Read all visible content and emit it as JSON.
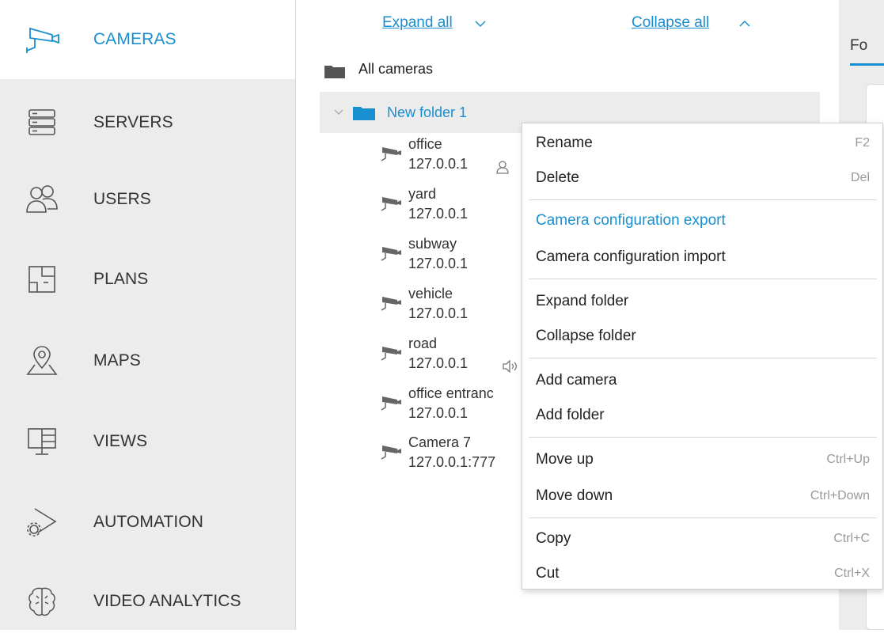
{
  "sidebar": {
    "items": [
      {
        "label": "CAMERAS",
        "icon": "camera-icon",
        "active": true
      },
      {
        "label": "SERVERS",
        "icon": "server-icon"
      },
      {
        "label": "USERS",
        "icon": "users-icon"
      },
      {
        "label": "PLANS",
        "icon": "floor-plan-icon"
      },
      {
        "label": "MAPS",
        "icon": "map-pin-icon"
      },
      {
        "label": "VIEWS",
        "icon": "monitor-grid-icon"
      },
      {
        "label": "AUTOMATION",
        "icon": "automation-gear-icon"
      },
      {
        "label": "VIDEO ANALYTICS",
        "icon": "brain-icon"
      }
    ],
    "active_color": "#1a8fd0"
  },
  "tree": {
    "expand_all": "Expand all",
    "collapse_all": "Collapse all",
    "root_label": "All cameras",
    "folder_label": "New folder 1",
    "cameras": [
      {
        "name": "office",
        "ip": "127.0.0.1",
        "badge": "user-icon"
      },
      {
        "name": "yard",
        "ip": "127.0.0.1"
      },
      {
        "name": "subway",
        "ip": "127.0.0.1"
      },
      {
        "name": "vehicle",
        "ip": "127.0.0.1"
      },
      {
        "name": "road",
        "ip": "127.0.0.1",
        "badge": "speaker-icon"
      },
      {
        "name": "office entranc",
        "ip": "127.0.0.1"
      },
      {
        "name": "Camera 7",
        "ip": "127.0.0.1:777"
      }
    ]
  },
  "right_panel": {
    "tab_text": "Fo"
  },
  "context_menu": {
    "items": [
      {
        "label": "Rename",
        "shortcut": "F2"
      },
      {
        "label": "Delete",
        "shortcut": "Del"
      },
      {
        "label": "Camera configuration export",
        "shortcut": "",
        "highlighted": true
      },
      {
        "label": "Camera configuration import",
        "shortcut": ""
      },
      {
        "label": "Expand folder",
        "shortcut": ""
      },
      {
        "label": "Collapse folder",
        "shortcut": ""
      },
      {
        "label": "Add camera",
        "shortcut": ""
      },
      {
        "label": "Add folder",
        "shortcut": ""
      },
      {
        "label": "Move up",
        "shortcut": "Ctrl+Up"
      },
      {
        "label": "Move down",
        "shortcut": "Ctrl+Down"
      },
      {
        "label": "Copy",
        "shortcut": "Ctrl+C"
      },
      {
        "label": "Cut",
        "shortcut": "Ctrl+X"
      }
    ]
  }
}
